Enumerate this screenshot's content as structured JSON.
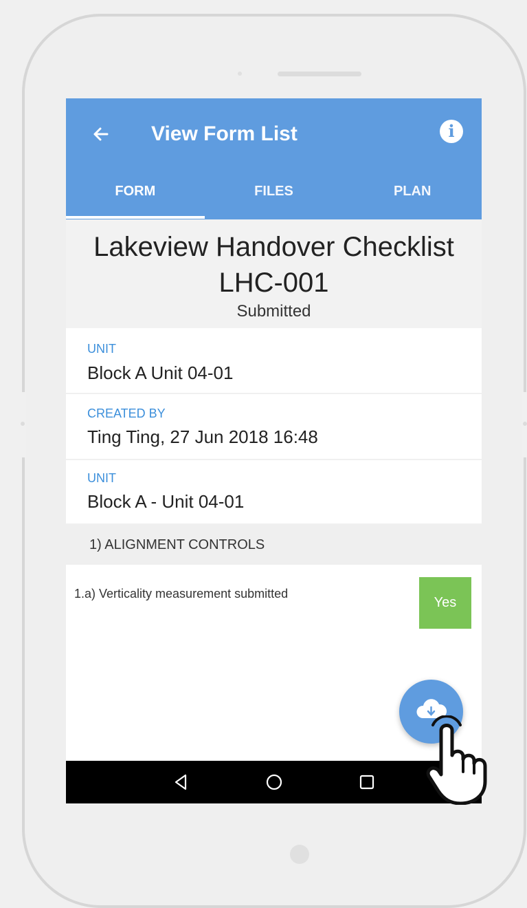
{
  "appbar": {
    "title": "View Form List",
    "back_icon": "arrow-left-icon",
    "info_icon": "info-icon",
    "info_glyph": "i"
  },
  "tabs": [
    {
      "label": "FORM",
      "active": true
    },
    {
      "label": "FILES",
      "active": false
    },
    {
      "label": "PLAN",
      "active": false
    }
  ],
  "form": {
    "title": "Lakeview Handover Checklist LHC-001",
    "status": "Submitted"
  },
  "fields": [
    {
      "label": "UNIT",
      "value": "Block A Unit 04-01"
    },
    {
      "label": "CREATED BY",
      "value": "Ting Ting, 27 Jun 2018 16:48"
    },
    {
      "label": "UNIT",
      "value": "Block A - Unit 04-01"
    }
  ],
  "section": {
    "label": "1) ALIGNMENT CONTROLS",
    "items": [
      {
        "text": "1.a) Verticality measurement submitted",
        "answer": "Yes"
      }
    ]
  },
  "fab": {
    "icon": "cloud-download-icon"
  },
  "navbar": {
    "icons": [
      "back-triangle-icon",
      "home-circle-icon",
      "recents-square-icon"
    ]
  },
  "colors": {
    "primary": "#5f9cdf",
    "field_label": "#3c8fdb",
    "yes_green": "#7bc456"
  }
}
